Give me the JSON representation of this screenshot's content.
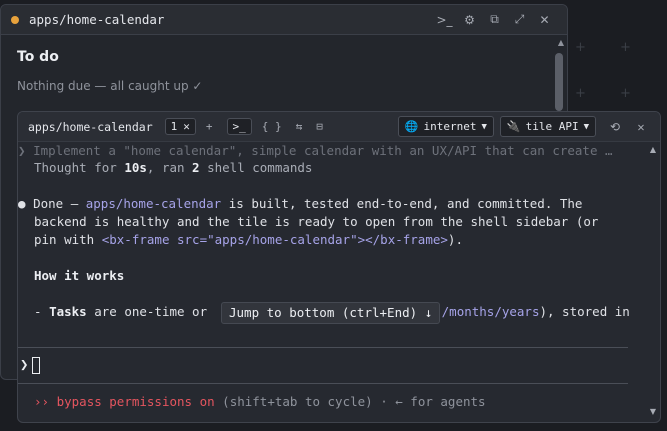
{
  "background": {
    "plus_glyph": "+"
  },
  "back_window": {
    "title": "apps/home-calendar",
    "status_dot_color": "#e8a23c",
    "icons": [
      "terminal-icon",
      "gear-icon",
      "copy-icon",
      "expand-icon",
      "close-icon"
    ],
    "icon_glyphs": [
      ">_",
      "⚙",
      "⧉",
      "⤢",
      "✕"
    ],
    "todo_title": "To do",
    "todo_empty": "Nothing due — all caught up ✓"
  },
  "terminal": {
    "name": "apps/home-calendar",
    "tab_count": "1",
    "tab_close": "✕",
    "add_label": "+",
    "prompt_btn": ">_",
    "braces_btn": "{ }",
    "swap_btn": "⇆",
    "list_btn": "⊟",
    "network_select": {
      "icon": "🌐",
      "value": "internet"
    },
    "tile_select": {
      "icon": "🔌",
      "value": "tile API"
    },
    "history_icon": "⟲",
    "close_icon": "✕",
    "lines": {
      "prompt_marker": "❯",
      "prompt_text": "Implement a \"home calendar\", simple calendar with an UX/API that can create …",
      "thought_pre": "Thought for ",
      "thought_time": "10s",
      "thought_mid": ", ran ",
      "thought_count": "2",
      "thought_post": " shell commands",
      "bullet": "●",
      "done_pre": "Done — ",
      "done_app": "apps/home-calendar",
      "done_post": " is built, tested end-to-end, and committed. The",
      "line2": "backend is healthy and the tile is ready to open from the shell sidebar (or",
      "line3_pre": "pin with ",
      "line3_code": "<bx-frame src=\"apps/home-calendar\"></bx-frame>",
      "line3_post": ").",
      "heading": "How it works",
      "tasks_dash": "- ",
      "tasks_bold": "Tasks",
      "tasks_mid": " are one-time or ",
      "tasks_code": "/months/years",
      "tasks_post": "), stored in"
    },
    "jump_label": "Jump to bottom (ctrl+End) ↓",
    "input_prompt": "❯",
    "status": {
      "arrows": "››",
      "bypass": " bypass permissions on",
      "hint": " (shift+tab to cycle) · ← for agents"
    }
  }
}
